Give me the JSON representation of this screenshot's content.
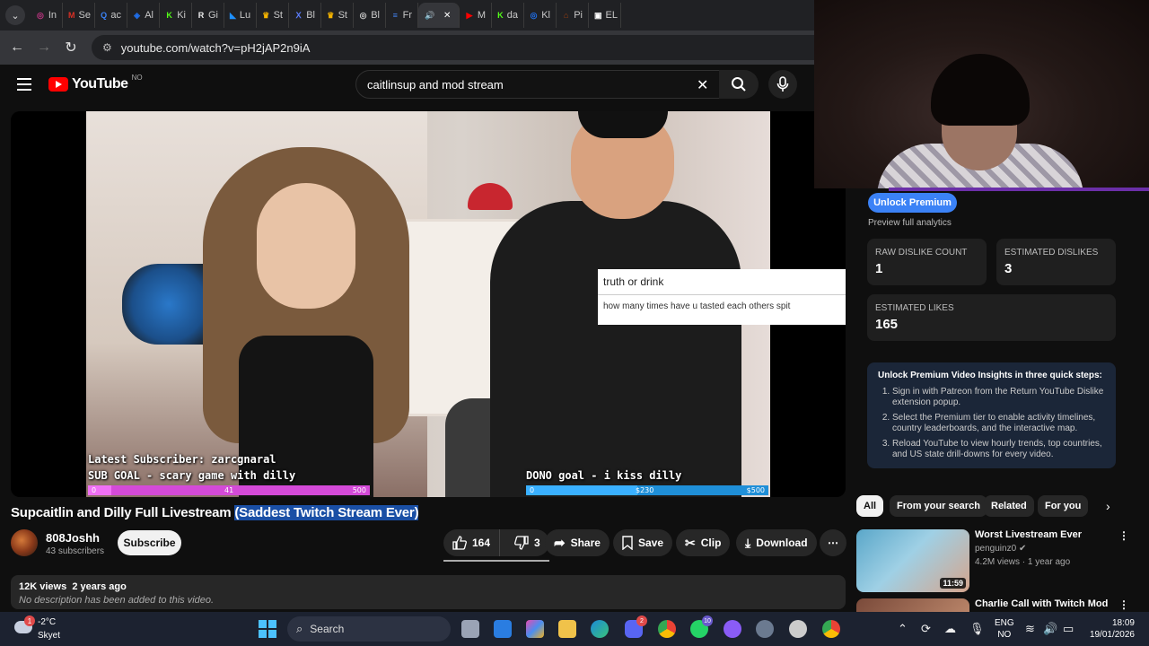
{
  "browser": {
    "tabs": [
      {
        "label": "In",
        "color": "#c13584",
        "glyph": "◎"
      },
      {
        "label": "Se",
        "color": "#d93025",
        "glyph": "M"
      },
      {
        "label": "ac",
        "color": "#3b82f6",
        "glyph": "Q"
      },
      {
        "label": "Al",
        "color": "#1f6feb",
        "glyph": "◈"
      },
      {
        "label": "Ki",
        "color": "#53fc18",
        "glyph": "K"
      },
      {
        "label": "Gi",
        "color": "#eeeeee",
        "glyph": "R"
      },
      {
        "label": "Lu",
        "color": "#1e90ff",
        "glyph": "◣"
      },
      {
        "label": "St",
        "color": "#f5b400",
        "glyph": "♛"
      },
      {
        "label": "Bl",
        "color": "#5b7cfa",
        "glyph": "Ⅹ"
      },
      {
        "label": "St",
        "color": "#f5b400",
        "glyph": "♛"
      },
      {
        "label": "Bl",
        "color": "#cccccc",
        "glyph": "◎"
      },
      {
        "label": "Fr",
        "color": "#4285f4",
        "glyph": "≡"
      },
      {
        "label": "",
        "color": "#aaaaaa",
        "glyph": "🔊",
        "active": true
      },
      {
        "label": "M",
        "color": "#ff0000",
        "glyph": "▶"
      },
      {
        "label": "da",
        "color": "#53fc18",
        "glyph": "K"
      },
      {
        "label": "Kl",
        "color": "#1f6feb",
        "glyph": "◎"
      },
      {
        "label": "Pi",
        "color": "#a04010",
        "glyph": "⌂"
      },
      {
        "label": "EL",
        "color": "#ffffff",
        "glyph": "▣"
      }
    ],
    "url": "youtube.com/watch?v=pH2jAP2n9iA"
  },
  "youtube": {
    "logo_text": "YouTube",
    "country_code": "NO",
    "search_value": "caitlinsup and mod stream"
  },
  "video": {
    "overlay": {
      "tod_title": "truth or drink",
      "tod_question": "how many times have u tasted each others spit",
      "latest_sub": "Latest Subscriber: zarcgnaral",
      "sub_goal": "SUB GOAL - scary game with dilly",
      "sub_goal_start": "0",
      "sub_goal_current": "41",
      "sub_goal_target": "500",
      "sub_goal_progress": 0.082,
      "dono_goal": "DONO goal - i kiss dilly",
      "dono_start": "0",
      "dono_current": "$230",
      "dono_target": "$500",
      "dono_progress": 0.46
    },
    "title_plain": "Supcaitlin and Dilly Full Livestream ",
    "title_selected": "(Saddest Twitch Stream Ever)",
    "channel": "808Joshh",
    "subscribers": "43 subscribers",
    "subscribe_label": "Subscribe",
    "likes": "164",
    "dislikes": "3",
    "share_label": "Share",
    "save_label": "Save",
    "clip_label": "Clip",
    "download_label": "Download",
    "views": "12K views",
    "age": "2 years ago",
    "description": "No description has been added to this video."
  },
  "ryd_panel": {
    "unlock_label": "Unlock Premium",
    "preview_text": "Preview full analytics",
    "raw_dislike_label": "RAW DISLIKE COUNT",
    "raw_dislike_value": "1",
    "est_dislikes_label": "ESTIMATED DISLIKES",
    "est_dislikes_value": "3",
    "est_likes_label": "ESTIMATED LIKES",
    "est_likes_value": "165",
    "steps_heading": "Unlock Premium Video Insights in three quick steps:",
    "steps": [
      "Sign in with Patreon from the Return YouTube Dislike extension popup.",
      "Select the Premium tier to enable activity timelines, country leaderboards, and the interactive map.",
      "Reload YouTube to view hourly trends, top countries, and US state drill-downs for every video."
    ]
  },
  "chips": [
    "All",
    "From your search",
    "Related",
    "For you"
  ],
  "recommendations": [
    {
      "title": "Worst Livestream Ever",
      "channel": "penguinz0",
      "meta": "4.2M views · 1 year ago",
      "duration": "11:59"
    },
    {
      "title": "Charlie Call with Twitch Mod",
      "channel": "",
      "meta": "",
      "duration": ""
    }
  ],
  "taskbar": {
    "temperature": "-2°C",
    "condition": "Skyet",
    "weather_badge": "1",
    "search_label": "Search",
    "discord_badge": "2",
    "whatsapp_badge": "10",
    "lang_top": "ENG",
    "lang_bottom": "NO",
    "time": "18:09",
    "date": "19/01/2026"
  }
}
